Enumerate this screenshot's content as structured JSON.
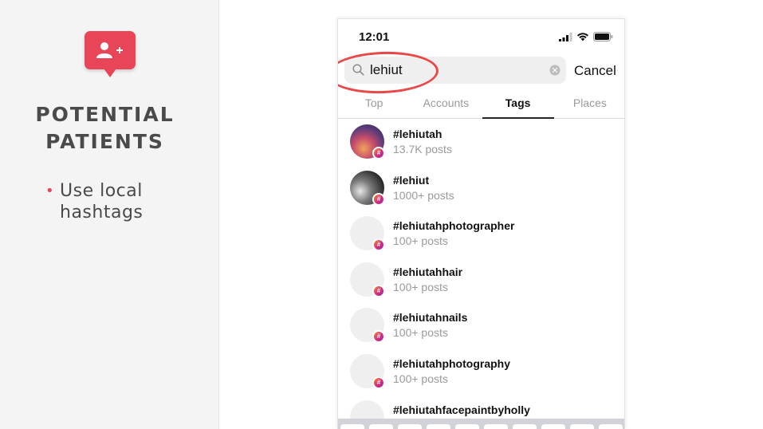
{
  "slide": {
    "title_line1": "POTENTIAL",
    "title_line2": "PATIENTS",
    "bullet_line1": "Use local",
    "bullet_line2": "hashtags",
    "badge_icon": "add-user-icon",
    "accent_color": "#e84558"
  },
  "phone": {
    "status": {
      "time": "12:01"
    },
    "search": {
      "value": "lehiut",
      "cancel_label": "Cancel"
    },
    "tabs": [
      {
        "label": "Top",
        "active": false
      },
      {
        "label": "Accounts",
        "active": false
      },
      {
        "label": "Tags",
        "active": true
      },
      {
        "label": "Places",
        "active": false
      }
    ],
    "results": [
      {
        "tag": "#lehiutah",
        "posts": "13.7K posts"
      },
      {
        "tag": "#lehiut",
        "posts": "1000+ posts"
      },
      {
        "tag": "#lehiutahphotographer",
        "posts": "100+ posts"
      },
      {
        "tag": "#lehiutahhair",
        "posts": "100+ posts"
      },
      {
        "tag": "#lehiutahnails",
        "posts": "100+ posts"
      },
      {
        "tag": "#lehiutahphotography",
        "posts": "100+ posts"
      },
      {
        "tag": "#lehiutahfacepaintbyholly",
        "posts": ""
      }
    ]
  }
}
